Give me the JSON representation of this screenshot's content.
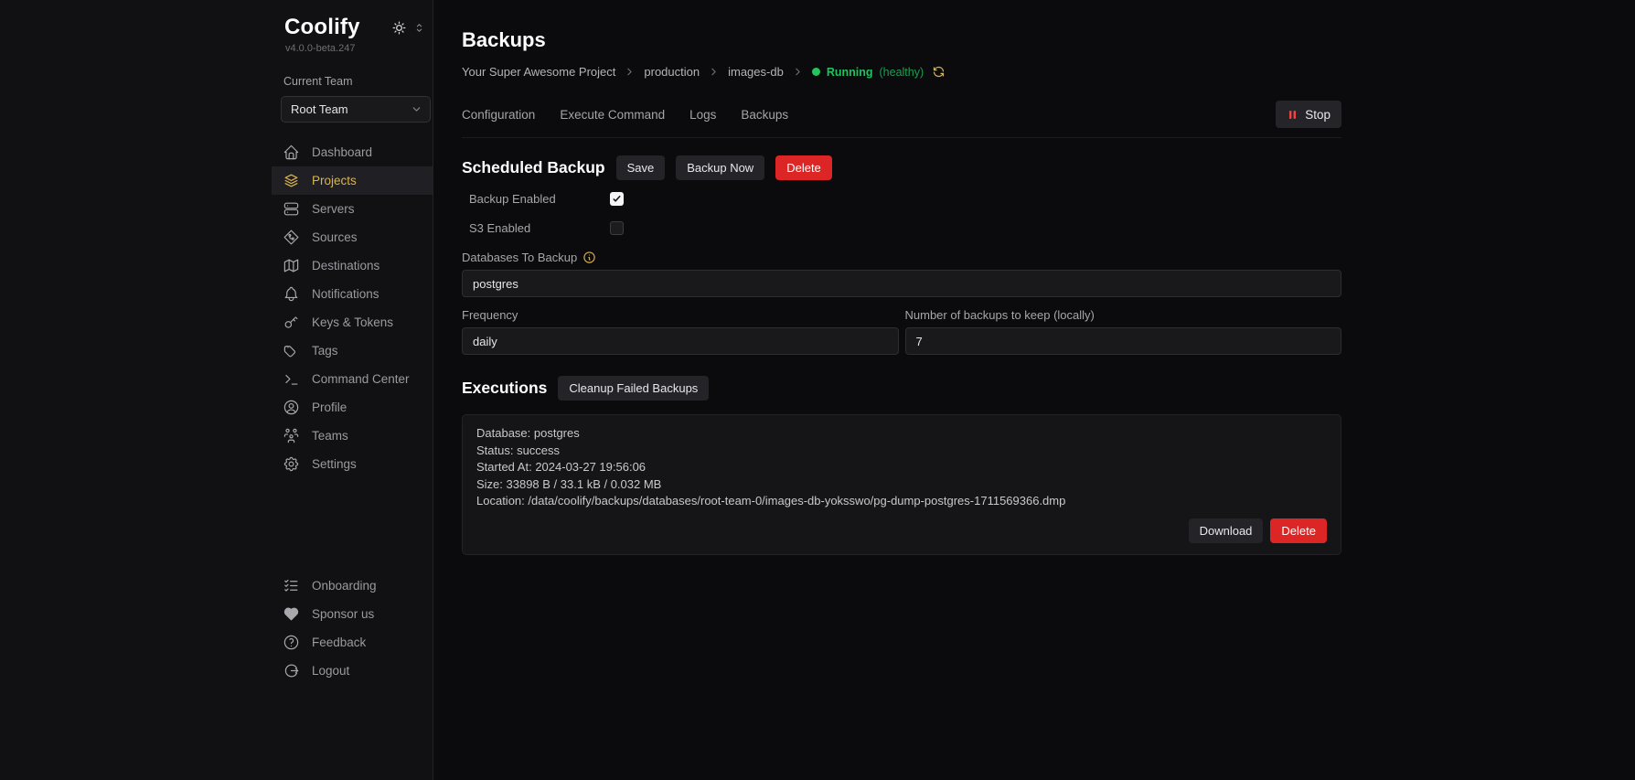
{
  "sidebar": {
    "logo": "Coolify",
    "version": "v4.0.0-beta.247",
    "current_team_label": "Current Team",
    "team_select_value": "Root Team",
    "theme_icon": "sun-icon",
    "nav": [
      {
        "label": "Dashboard",
        "icon": "home-icon",
        "active": false
      },
      {
        "label": "Projects",
        "icon": "layers-icon",
        "active": true
      },
      {
        "label": "Servers",
        "icon": "server-icon",
        "active": false
      },
      {
        "label": "Sources",
        "icon": "git-source-icon",
        "active": false
      },
      {
        "label": "Destinations",
        "icon": "map-icon",
        "active": false
      },
      {
        "label": "Notifications",
        "icon": "bell-icon",
        "active": false
      },
      {
        "label": "Keys & Tokens",
        "icon": "key-icon",
        "active": false
      },
      {
        "label": "Tags",
        "icon": "tag-icon",
        "active": false
      },
      {
        "label": "Command Center",
        "icon": "terminal-icon",
        "active": false
      },
      {
        "label": "Profile",
        "icon": "user-circle-icon",
        "active": false
      },
      {
        "label": "Teams",
        "icon": "users-group-icon",
        "active": false
      },
      {
        "label": "Settings",
        "icon": "gear-icon",
        "active": false
      }
    ],
    "footer_nav": [
      {
        "label": "Onboarding",
        "icon": "checklist-icon"
      },
      {
        "label": "Sponsor us",
        "icon": "heart-icon"
      },
      {
        "label": "Feedback",
        "icon": "help-circle-icon"
      },
      {
        "label": "Logout",
        "icon": "logout-icon"
      }
    ]
  },
  "header": {
    "title": "Backups",
    "breadcrumb": [
      "Your Super Awesome Project",
      "production",
      "images-db"
    ],
    "status": {
      "label": "Running",
      "sub": "(healthy)"
    }
  },
  "tabs": [
    {
      "label": "Configuration"
    },
    {
      "label": "Execute Command"
    },
    {
      "label": "Logs"
    },
    {
      "label": "Backups"
    }
  ],
  "stop_button_label": "Stop",
  "scheduled": {
    "heading": "Scheduled Backup",
    "save_label": "Save",
    "backup_now_label": "Backup Now",
    "delete_label": "Delete",
    "backup_enabled_label": "Backup Enabled",
    "backup_enabled": true,
    "s3_enabled_label": "S3 Enabled",
    "s3_enabled": false,
    "databases_label": "Databases To Backup",
    "databases_value": "postgres",
    "frequency_label": "Frequency",
    "frequency_value": "daily",
    "keep_label": "Number of backups to keep (locally)",
    "keep_value": "7"
  },
  "executions": {
    "heading": "Executions",
    "cleanup_label": "Cleanup Failed Backups",
    "items": [
      {
        "database": "Database: postgres",
        "status": "Status: success",
        "started_at": "Started At: 2024-03-27 19:56:06",
        "size": "Size: 33898 B / 33.1 kB / 0.032 MB",
        "location": "Location: /data/coolify/backups/databases/root-team-0/images-db-yoksswo/pg-dump-postgres-1711569366.dmp",
        "download_label": "Download",
        "delete_label": "Delete"
      }
    ]
  },
  "colors": {
    "accent_yellow": "#dcb44c",
    "status_green": "#22c55e",
    "danger_red": "#dc2626",
    "sponsor_pink": "#e0367f",
    "background": "#0b0b0d",
    "sidebar_background": "#111113"
  }
}
